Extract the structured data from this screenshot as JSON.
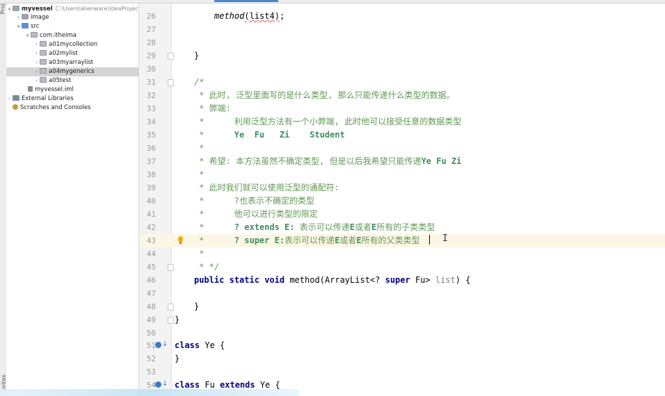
{
  "side_strip": {
    "top_label": "Proje",
    "bottom_label": "orites"
  },
  "tree": [
    {
      "name": "myvessel",
      "path": "C:\\Users\\alienware\\IdeaProjects\\",
      "bold": true
    },
    {
      "name": "image"
    },
    {
      "name": "src"
    },
    {
      "name": "com.itheima"
    },
    {
      "name": "a01mycollection"
    },
    {
      "name": "a02mylist"
    },
    {
      "name": "a03myarraylist"
    },
    {
      "name": "a04mygenerics"
    },
    {
      "name": "a05test"
    },
    {
      "name": "myvessel.iml"
    },
    {
      "name": "External Libraries"
    },
    {
      "name": "Scratches and Consoles"
    }
  ],
  "editor": {
    "line_numbers": [
      "26",
      "27",
      "28",
      "29",
      "30",
      "31",
      "32",
      "33",
      "34",
      "35",
      "36",
      "37",
      "38",
      "39",
      "40",
      "41",
      "42",
      "43",
      "44",
      "45",
      "46",
      "47",
      "48",
      "49",
      "50",
      "51",
      "52",
      "53",
      "54"
    ],
    "l26_method": "method",
    "l26_arg": "(list4)",
    "l26_end": ";",
    "l29": "}",
    "l31": "/*",
    "l32": " * 此时, 泛型里面写的是什么类型, 那么只能传递什么类型的数据。",
    "l33": " * 弊端:",
    "l34": " *      利用泛型方法有一个小弊端, 此时他可以接受任意的数据类型",
    "l35_star": " *      ",
    "l35_types": "Ye  Fu   Zi    Student",
    "l36": " *",
    "l37_text": " * 希望: 本方法虽然不确定类型, 但是以后我希望只能传递",
    "l37_types": "Ye Fu Zi",
    "l38": " *",
    "l39": " * 此时我们就可以使用泛型的通配符:",
    "l40": " *      ?也表示不确定的类型",
    "l41": " *      他可以进行类型的限定",
    "l42_star": " *      ",
    "l42_bound": "? extends E:",
    "l42_a": " 表示可以传递",
    "l42_e1": "E",
    "l42_b": "或者",
    "l42_e2": "E",
    "l42_c": "所有的子类类型",
    "l43_star": " *      ",
    "l43_bound": "? super E:",
    "l43_a": "表示可以传递",
    "l43_e1": "E",
    "l43_b": "或者",
    "l43_e2": "E",
    "l43_c": "所有的父类类型",
    "l44": " *",
    "l45": " * */",
    "l46_public": "public",
    "l46_static": "static",
    "l46_void": "void",
    "l46_a": " method(ArrayList<? ",
    "l46_super": "super",
    "l46_b": " Fu> ",
    "l46_param": "list",
    "l46_c": ") {",
    "l48": "}",
    "l49": "}",
    "l51_class": "class",
    "l51_rest": " Ye {",
    "l52": "}",
    "l54_class": "class",
    "l54_mid": " Fu ",
    "l54_extends": "extends",
    "l54_rest": " Ye {"
  },
  "colors": {
    "keyword": "#000080",
    "comment": "#629755",
    "current_line": "#fcf6e5"
  }
}
